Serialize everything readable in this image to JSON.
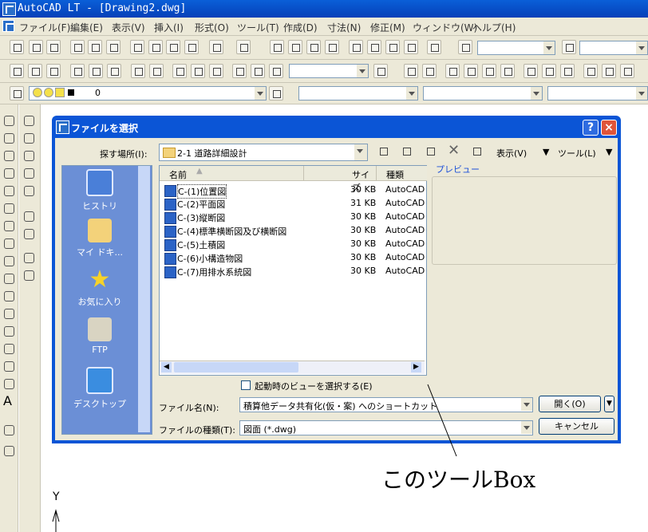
{
  "window": {
    "title": "AutoCAD LT - [Drawing2.dwg]"
  },
  "menu": [
    "ファイル(F)",
    "編集(E)",
    "表示(V)",
    "挿入(I)",
    "形式(O)",
    "ツール(T)",
    "作成(D)",
    "寸法(N)",
    "修正(M)",
    "ウィンドウ(W)",
    "ヘルプ(H)"
  ],
  "layer": {
    "value": "0"
  },
  "dialog": {
    "title": "ファイルを選択",
    "lookin_label": "探す場所(I):",
    "lookin_value": "2-1 道路詳細設計",
    "views_label": "表示(V)",
    "tools_label": "ツール(L)",
    "places": [
      "ヒストリ",
      "マイ ドキ...",
      "お気に入り",
      "FTP",
      "デスクトップ"
    ],
    "columns": {
      "name": "名前",
      "size": "サイズ",
      "type": "種類"
    },
    "preview_label": "プレビュー",
    "files": [
      {
        "name": "C-(1)位置図",
        "size": "30 KB",
        "type": "AutoCAD"
      },
      {
        "name": "C-(2)平面図",
        "size": "31 KB",
        "type": "AutoCAD"
      },
      {
        "name": "C-(3)縦断図",
        "size": "30 KB",
        "type": "AutoCAD"
      },
      {
        "name": "C-(4)標準横断図及び横断図",
        "size": "30 KB",
        "type": "AutoCAD"
      },
      {
        "name": "C-(5)土積図",
        "size": "30 KB",
        "type": "AutoCAD"
      },
      {
        "name": "C-(6)小構造物図",
        "size": "30 KB",
        "type": "AutoCAD"
      },
      {
        "name": "C-(7)用排水系統図",
        "size": "30 KB",
        "type": "AutoCAD"
      }
    ],
    "startup_view_label": "起動時のビューを選択する(E)",
    "filename_label": "ファイル名(N):",
    "filename_value": "積算他データ共有化(仮・案) へのショートカット",
    "filetype_label": "ファイルの種類(T):",
    "filetype_value": "図面 (*.dwg)",
    "open_label": "開く(O)",
    "cancel_label": "キャンセル"
  },
  "annotation": "このツールBox",
  "ucs": {
    "y_label": "Y"
  },
  "colors": {
    "titlebar": "#0a5fd8",
    "places_bg": "#6b8fd6",
    "chrome": "#ece9d8"
  }
}
